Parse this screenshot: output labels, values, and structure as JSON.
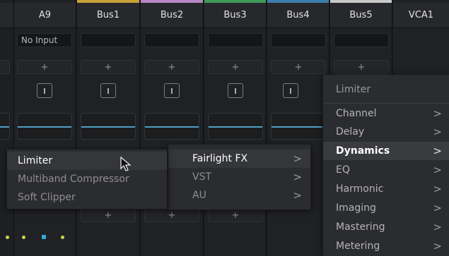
{
  "colors": {
    "bus1": "#c9a237",
    "bus2": "#b687c4",
    "bus3": "#3f9a5a",
    "bus4": "#3c7fae",
    "bus5": "#c9c9c9",
    "eq_line": "#4fa0c6",
    "selected_text": "#ffffff",
    "dimmed_text": "#8e8e8e"
  },
  "mixer": {
    "channels": [
      {
        "name": "A9",
        "input": "No Input"
      },
      {
        "name": "Bus1",
        "input": ""
      },
      {
        "name": "Bus2",
        "input": ""
      },
      {
        "name": "Bus3",
        "input": ""
      },
      {
        "name": "Bus4",
        "input": ""
      },
      {
        "name": "Bus5",
        "input": ""
      },
      {
        "name": "VCA1",
        "input": ""
      }
    ],
    "add_label": "+",
    "bypass_icon": "bypass-icon"
  },
  "effects_menu": {
    "header": "Limiter",
    "items": [
      {
        "label": "Channel",
        "has_submenu": true
      },
      {
        "label": "Delay",
        "has_submenu": true
      },
      {
        "label": "Dynamics",
        "has_submenu": true,
        "selected": true
      },
      {
        "label": "EQ",
        "has_submenu": true
      },
      {
        "label": "Harmonic",
        "has_submenu": true
      },
      {
        "label": "Imaging",
        "has_submenu": true
      },
      {
        "label": "Mastering",
        "has_submenu": true
      },
      {
        "label": "Metering",
        "has_submenu": true
      }
    ],
    "chevron": ">"
  },
  "fx_source_menu": {
    "items": [
      {
        "label": "Fairlight FX",
        "selected": true
      },
      {
        "label": "VST",
        "selected": false
      },
      {
        "label": "AU",
        "selected": false
      }
    ]
  },
  "dynamics_menu": {
    "items": [
      {
        "label": "Limiter",
        "highlighted": true
      },
      {
        "label": "Multiband Compressor",
        "highlighted": false
      },
      {
        "label": "Soft Clipper",
        "highlighted": false
      }
    ]
  }
}
